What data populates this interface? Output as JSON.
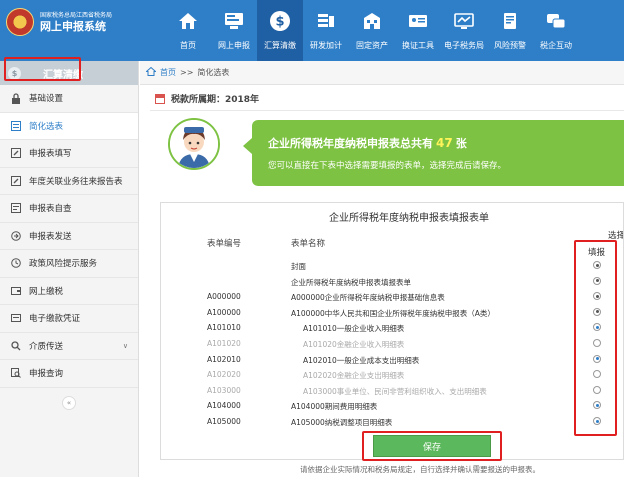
{
  "header": {
    "brand_sub": "国家税务总局江西省税务局",
    "brand_main": "网上申报系统",
    "nav": [
      {
        "label": "首页",
        "icon": "home-icon",
        "active": false
      },
      {
        "label": "网上申报",
        "icon": "monitor-icon",
        "active": false
      },
      {
        "label": "汇算清缴",
        "icon": "dollar-icon",
        "active": true
      },
      {
        "label": "研发加计",
        "icon": "coins-icon",
        "active": false
      },
      {
        "label": "固定资产",
        "icon": "building-icon",
        "active": false
      },
      {
        "label": "换证工具",
        "icon": "id-card-icon",
        "active": false
      },
      {
        "label": "电子税务局",
        "icon": "network-icon",
        "active": false
      },
      {
        "label": "风险预警",
        "icon": "warning-doc-icon",
        "active": false
      },
      {
        "label": "税企互动",
        "icon": "chat-icon",
        "active": false
      }
    ]
  },
  "sidebar": {
    "title": "汇算清缴",
    "items": [
      {
        "label": "基础设置",
        "icon": "lock-icon"
      },
      {
        "label": "简化选表",
        "icon": "list-icon",
        "active": true
      },
      {
        "label": "申报表填写",
        "icon": "edit-icon"
      },
      {
        "label": "年度关联业务往来报告表",
        "icon": "edit-icon"
      },
      {
        "label": "申报表自查",
        "icon": "document-icon"
      },
      {
        "label": "申报表发送",
        "icon": "send-icon"
      },
      {
        "label": "政策风险提示服务",
        "icon": "clock-icon"
      },
      {
        "label": "网上缴税",
        "icon": "wallet-icon"
      },
      {
        "label": "电子缴款凭证",
        "icon": "receipt-icon"
      },
      {
        "label": "介质传送",
        "icon": "search-icon",
        "has_caret": true
      },
      {
        "label": "申报查询",
        "icon": "query-icon"
      }
    ]
  },
  "breadcrumb": {
    "home": "首页",
    "sep": ">>",
    "current": "简化选表"
  },
  "main": {
    "year_text": "税款所属期：2018年",
    "banner_title_pre": "企业所得税年度纳税申报表总共有",
    "banner_count": "47",
    "banner_title_post": "张",
    "banner_sub": "您可以直接在下表中选择需要填报的表单，选择完成后请保存。"
  },
  "table": {
    "title": "企业所得税年度纳税申报表填报表单",
    "col_code": "表单编号",
    "col_name": "表单名称",
    "col_select_group": "选择填",
    "col_select": "填报",
    "rows": [
      {
        "code": "",
        "name": "封面",
        "indent": 0,
        "checked": true,
        "disabled": false
      },
      {
        "code": "",
        "name": "企业所得税年度纳税申报表填报表单",
        "indent": 0,
        "checked": true,
        "disabled": false
      },
      {
        "code": "A000000",
        "name": "A000000企业所得税年度纳税申报基础信息表",
        "indent": 0,
        "checked": true,
        "disabled": false
      },
      {
        "code": "A100000",
        "name": "A100000中华人民共和国企业所得税年度纳税申报表（A类）",
        "indent": 0,
        "checked": true,
        "disabled": false
      },
      {
        "code": "A101010",
        "name": "A101010一般企业收入明细表",
        "indent": 1,
        "checked": true,
        "disabled": false,
        "blue": true
      },
      {
        "code": "A101020",
        "name": "A101020金融企业收入明细表",
        "indent": 1,
        "checked": false,
        "disabled": true
      },
      {
        "code": "A102010",
        "name": "A102010一般企业成本支出明细表",
        "indent": 1,
        "checked": true,
        "disabled": false,
        "blue": true
      },
      {
        "code": "A102020",
        "name": "A102020金融企业支出明细表",
        "indent": 1,
        "checked": false,
        "disabled": true
      },
      {
        "code": "A103000",
        "name": "A103000事业单位、民间非营利组织收入、支出明细表",
        "indent": 1,
        "checked": false,
        "disabled": true
      },
      {
        "code": "A104000",
        "name": "A104000期间费用明细表",
        "indent": 0,
        "checked": true,
        "disabled": false,
        "blue": true
      },
      {
        "code": "A105000",
        "name": "A105000纳税调整项目明细表",
        "indent": 0,
        "checked": true,
        "disabled": false,
        "blue": true
      }
    ]
  },
  "actions": {
    "save": "保存"
  },
  "footer_note": "请依据企业实际情况和税务局规定，自行选择并确认需要报送的申报表。",
  "colors": {
    "header": "#2f7fc8",
    "banner": "#7dc242",
    "highlight": "#e02020",
    "save": "#5cb85c"
  }
}
